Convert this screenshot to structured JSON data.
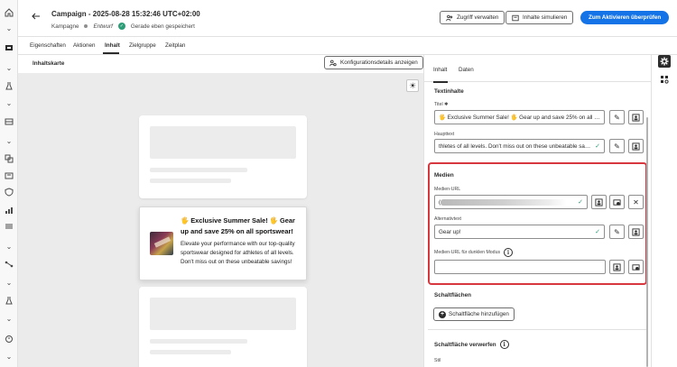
{
  "header": {
    "title": "Campaign - 2025-08-28 15:32:46 UTC+02:00",
    "type_label": "Kampagne",
    "status_draft": "Entwurf",
    "save_status": "Gerade eben gespeichert",
    "btn_access": "Zugriff verwalten",
    "btn_simulate": "Inhalte simulieren",
    "btn_review": "Zum Aktivieren überprüfen"
  },
  "tabs": [
    "Eigenschaften",
    "Aktionen",
    "Inhalt",
    "Zielgruppe",
    "Zeitplan"
  ],
  "active_tab": "Inhalt",
  "canvas": {
    "title": "Inhaltskarte",
    "config_button": "Konfigurationsdetails anzeigen"
  },
  "message": {
    "title": "🖐 Exclusive Summer Sale! 🖐 Gear up and save 25% on all sportswear!",
    "body": "Elevate your performance with our top-quality sportswear designed for athletes of all levels. Don't miss out on these unbeatable savings!"
  },
  "panel": {
    "tabs": [
      "Inhalt",
      "Daten"
    ],
    "text_section": "Textinhalte",
    "title_label": "Titel",
    "title_value": "🖐 Exclusive Summer Sale! 🖐 Gear up and save 25% on all sport...",
    "body_label": "Haupttext",
    "body_value": "thletes of all levels. Don't miss out on these unbeatable savings!",
    "media_section": "Medien",
    "media_url_label": "Medien-URL",
    "media_url_value": "(",
    "alt_label": "Alternativtext",
    "alt_value": "Gear up!",
    "dark_url_label": "Medien-URL für dunklen Modus",
    "dark_url_value": "",
    "buttons_section": "Schaltflächen",
    "add_button": "Schaltfläche hinzufügen",
    "dismiss_section": "Schaltfläche verwerfen",
    "style_label": "Stil"
  },
  "icons": {
    "back": "arrow-left-icon",
    "theme": "sun-icon",
    "settings": "gear-icon"
  },
  "colors": {
    "primary": "#1473e6",
    "success": "#2d9d78",
    "highlight": "#d7373f"
  }
}
